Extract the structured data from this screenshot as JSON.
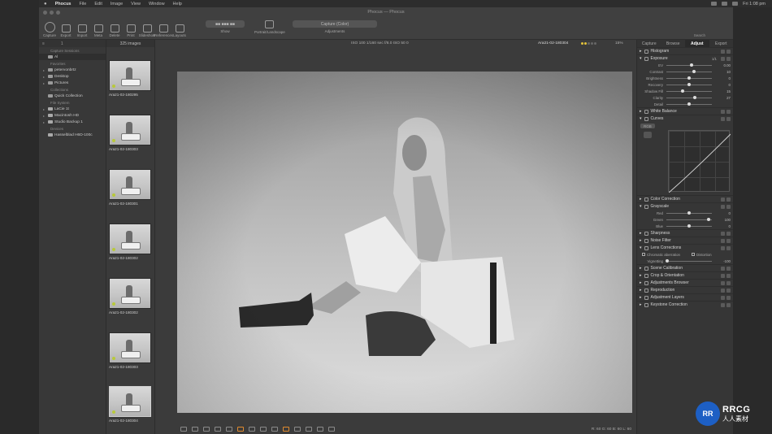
{
  "menubar": {
    "app": "Phocus",
    "items": [
      "File",
      "Edit",
      "Image",
      "View",
      "Window",
      "Help"
    ],
    "clock": "Fri 1:08 pm"
  },
  "window": {
    "title": "Phocus — Phocus"
  },
  "toolbar": {
    "tools": [
      "Capture",
      "Export",
      "Import",
      "Meta",
      "Delete",
      "Print",
      "Slideshow",
      "Preferences",
      "Layouts"
    ],
    "show_box": "■■  ■■■  ■■",
    "show_label": "Show",
    "portrait_label": "Portrait/Landscape",
    "adjust_box": "Capture (Color)",
    "adjust_label": "Adjustments",
    "search_label": "Search"
  },
  "library": {
    "head_left": "≡",
    "head_right": "1",
    "sections": {
      "collections": "Capture Sessions",
      "favorites": "Favorites",
      "collections2": "Collections",
      "filesystem": "File System",
      "devices": "Devices"
    },
    "root_item": "Al",
    "favorites": [
      "petervonbrtz",
      "Desktop",
      "Pictures"
    ],
    "collections": [
      "Quick Collection"
    ],
    "filesystem": [
      "LaCie 1t",
      "Macintosh HD",
      "Studio Backup 1"
    ],
    "devices": [
      "Hasselblad H6D-100c"
    ]
  },
  "browser": {
    "count": "325 images",
    "thumbs": [
      "Ara21-02-180295",
      "Ara21-02-180303",
      "Ara21-02-180301",
      "Ara21-02-180302",
      "Ara21-02-180302",
      "Ara21-02-180303",
      "Ara21-02-180304"
    ]
  },
  "viewer": {
    "exif": "ISO 100  1/160 sec  f/8.0  ISO 50 0",
    "filename": "Ara21-02-180304",
    "zoom": "15%",
    "rating_on": 2,
    "rating_total": 5,
    "coords": "R:  60  G:  60  B:  60  L:  60"
  },
  "tools": {
    "tabs": [
      "Capture",
      "Browse",
      "Adjust",
      "Export"
    ],
    "active_tab": "Adjust",
    "sections": {
      "histogram": "Histogram",
      "exposure": "Exposure",
      "white_balance": "White Balance",
      "curves": "Curves",
      "color_correction": "Color Correction",
      "grayscale": "Grayscale",
      "sharpness": "Sharpness",
      "noise_filter": "Noise Filter",
      "lens_corrections": "Lens Corrections",
      "scene_calibration": "Scene Calibration",
      "crop": "Crop & Orientation",
      "adj_browser": "Adjustments Browser",
      "reproduction": "Reproduction",
      "adj_layers": "Adjustment Layers",
      "keystone": "Keystone Correction"
    },
    "exposure_tag": "1/1",
    "exposure_rows": [
      {
        "label": "EV",
        "value": "0.00",
        "pos": 0.55
      },
      {
        "label": "Contrast",
        "value": "10",
        "pos": 0.6
      },
      {
        "label": "Brightness",
        "value": "0",
        "pos": 0.5
      },
      {
        "label": "Recovery",
        "value": "0",
        "pos": 0.5
      },
      {
        "label": "Shadow Fill",
        "value": "15",
        "pos": 0.35
      },
      {
        "label": "Clarity",
        "value": "27",
        "pos": 0.62
      },
      {
        "label": "Detail",
        "value": "",
        "pos": 0.5
      }
    ],
    "curves_channel": "RGB",
    "grayscale_rows": [
      {
        "label": "Red",
        "value": "0",
        "pos": 0.5
      },
      {
        "label": "Green",
        "value": "100",
        "pos": 0.92
      },
      {
        "label": "Blue",
        "value": "0",
        "pos": 0.5
      }
    ],
    "lens_checks": [
      "Chromatic aberration",
      "Distortion"
    ],
    "vignetting_label": "Vignetting",
    "vignetting_value": "-100"
  },
  "watermark": {
    "logo": "RR",
    "title": "RRCG",
    "subtitle": "人人素材"
  }
}
